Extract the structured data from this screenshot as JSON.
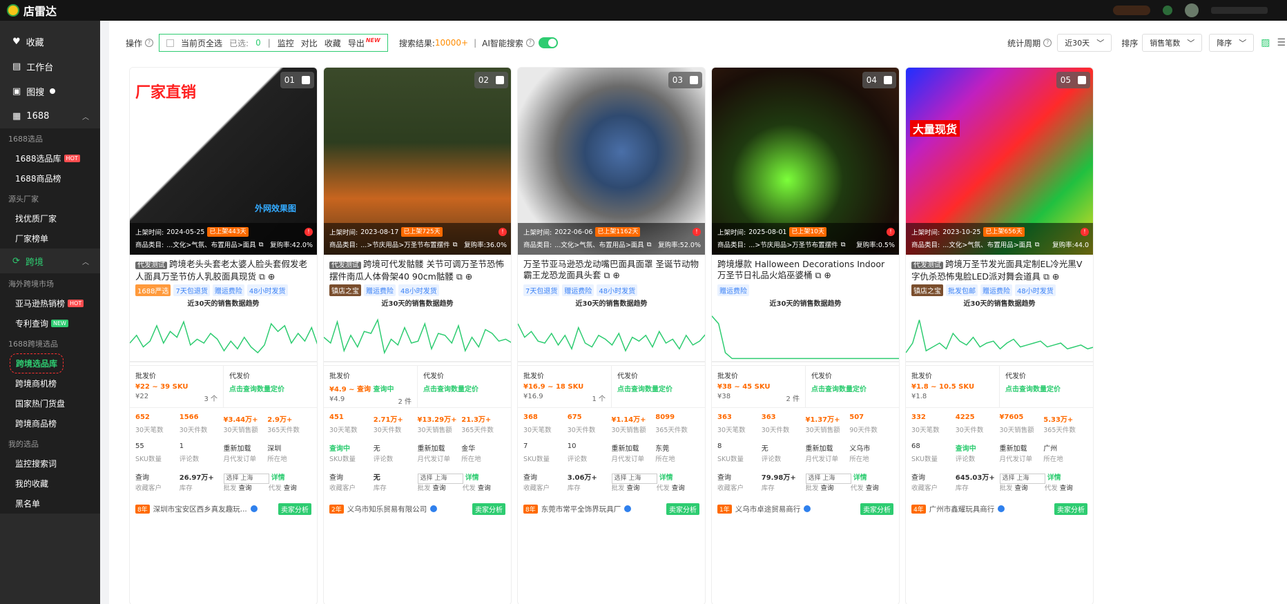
{
  "app": {
    "name": "店雷达"
  },
  "sidebar": {
    "items": [
      {
        "label": "收藏",
        "icon": "heart-icon"
      },
      {
        "label": "工作台",
        "icon": "workbench-icon"
      },
      {
        "label": "图搜",
        "icon": "image-search-icon"
      },
      {
        "label": "1688",
        "icon": "shop-icon"
      }
    ],
    "group_1688_selection": "1688选品",
    "item_1688_library": "1688选品库",
    "item_1688_goods": "1688商品榜",
    "group_factory": "源头厂家",
    "item_find_factory": "找优质厂家",
    "item_factory_rank": "厂家榜单",
    "cross_border": "跨境",
    "group_overseas": "海外跨境市场",
    "item_amazon": "亚马逊热销榜",
    "item_patent": "专利查询",
    "group_1688_cross": "1688跨境选品",
    "item_cross_library": "跨境选品库",
    "item_cross_opportunity": "跨境商机榜",
    "item_national_hot": "国家热门货盘",
    "item_cross_goods": "跨境商品榜",
    "group_my": "我的选品",
    "item_monitor": "监控搜索词",
    "item_my_fav": "我的收藏",
    "item_blacklist": "黑名单",
    "hot": "HOT",
    "new": "NEW"
  },
  "toolbar": {
    "op_label": "操作",
    "select_page": "当前页全选",
    "selected_label": "已选:",
    "selected_count": "0",
    "monitor": "监控",
    "compare": "对比",
    "favorite": "收藏",
    "export": "导出",
    "export_new": "NEW",
    "result_label": "搜索结果:",
    "result_count": "10000+",
    "ai_search": "AI智能搜索",
    "period_label": "统计周期",
    "period_value": "近30天",
    "sort_label": "排序",
    "sort_value": "销售笔数",
    "order_value": "降序"
  },
  "labels": {
    "listed_time": "上架时间:",
    "category": "商品类目:",
    "trend_title": "近30天的销售数据趋势",
    "wholesale": "批发价",
    "dropship": "代发价",
    "dropship_query": "点击查询数量定价",
    "m30_orders": "30天笔数",
    "m30_pieces": "30天件数",
    "m30_sales": "30天销售额",
    "y365_pieces": "365天件数",
    "d90_pieces": "90天件数",
    "sku_count": "SKU数量",
    "reviews": "评论数",
    "reload": "重新加载",
    "monthly_orders": "月代发订单",
    "location": "所在地",
    "fav_customers": "收藏客户",
    "stock": "库存",
    "wholesale_short": "批发",
    "dropship_short": "代发",
    "query": "查询",
    "detail": "详情",
    "seller_analysis": "卖家分析",
    "select_loc": "选择 上海"
  },
  "products": [
    {
      "no": "01",
      "date": "2024-05-25",
      "listed_badge": "已上架443天",
      "cat": "...文化>气氛、布置用品>面具",
      "repurchase": "复购率:42.0%",
      "tagline": "代发测试",
      "title": "跨境老头头套老太婆人脸头套假发老人面具万圣节仿人乳胶面具现货",
      "tags": [
        "1688严选",
        "7天包退货",
        "赠运费险",
        "48小时发货"
      ],
      "tag_types": [
        "o",
        "",
        "",
        ""
      ],
      "price": "¥22 ~ 39 SKU",
      "price_sub": "¥22",
      "price_count": "3 个",
      "orders": "652",
      "pieces": "1566",
      "sales": "¥3.44万+",
      "year": "2.9万+",
      "year_label": "365天件数",
      "sku": "55",
      "reviews": "1",
      "loc": "深圳",
      "fav": "查询",
      "stock": "26.97万+",
      "years": "8年",
      "company": "深圳市宝安区西乡真友趣玩..."
    },
    {
      "no": "02",
      "date": "2023-08-17",
      "listed_badge": "已上架725天",
      "cat": "...>节庆用品>万圣节布置摆件",
      "repurchase": "复购率:36.0%",
      "tagline": "代发测试",
      "title": "跨境可代发骷髅 关节可调万圣节恐怖摆件南瓜人体骨架40 90cm骷髅",
      "tags": [
        "镇店之宝",
        "赠运费险",
        "48小时发货"
      ],
      "tag_types": [
        "b",
        "",
        ""
      ],
      "price": "¥4.9 ~ 查询",
      "price_extra": "查询中",
      "price_sub": "¥4.9",
      "price_count": "2 件",
      "orders": "451",
      "pieces": "2.71万+",
      "sales": "¥13.29万+",
      "year": "21.3万+",
      "year_label": "365天件数",
      "sku": "查询中",
      "reviews": "无",
      "loc": "金华",
      "fav": "查询",
      "stock": "无",
      "years": "2年",
      "company": "义乌市知乐贸易有限公司"
    },
    {
      "no": "03",
      "date": "2022-06-06",
      "listed_badge": "已上架1162天",
      "cat": "...文化>气氛、布置用品>面具",
      "repurchase": "复购率:52.0%",
      "tagline": "",
      "title": "万圣节亚马逊恐龙动嘴巴面具面罩 圣诞节动物霸王龙恐龙面具头套",
      "tags": [
        "7天包退货",
        "赠运费险",
        "48小时发货"
      ],
      "tag_types": [
        "",
        "",
        ""
      ],
      "price": "¥16.9 ~ 18 SKU",
      "price_sub": "¥16.9",
      "price_count": "1 个",
      "orders": "368",
      "pieces": "675",
      "sales": "¥1.14万+",
      "year": "8099",
      "year_label": "365天件数",
      "sku": "7",
      "reviews": "10",
      "loc": "东莞",
      "fav": "查询",
      "stock": "3.06万+",
      "years": "8年",
      "company": "东莞市常平全饰界玩具厂"
    },
    {
      "no": "04",
      "date": "2025-08-01",
      "listed_badge": "已上架10天",
      "cat": "...>节庆用品>万圣节布置摆件",
      "repurchase": "复购率:0.5%",
      "tagline": "",
      "title": "跨境爆款 Halloween Decorations Indoor 万圣节日礼品火焰巫婆桶",
      "tags": [
        "赠运费险"
      ],
      "tag_types": [
        ""
      ],
      "price": "¥38 ~ 45 SKU",
      "price_sub": "¥38",
      "price_count": "2 件",
      "orders": "363",
      "pieces": "363",
      "sales": "¥1.37万+",
      "year": "507",
      "year_label": "90天件数",
      "sku": "8",
      "reviews": "无",
      "loc": "义乌市",
      "fav": "查询",
      "stock": "79.98万+",
      "years": "1年",
      "company": "义乌市卓途贸易商行"
    },
    {
      "no": "05",
      "date": "2023-10-25",
      "listed_badge": "已上架656天",
      "cat": "...文化>气氛、布置用品>面具",
      "repurchase": "复购率:44.0",
      "tagline": "代发测试",
      "title": "跨境万圣节发光面具定制EL冷光黑V字仇杀恐怖鬼脸LED派对舞会道具",
      "tags": [
        "镇店之宝",
        "批发包邮",
        "赠运费险",
        "48小时发货"
      ],
      "tag_types": [
        "b",
        "",
        "",
        ""
      ],
      "price": "¥1.8 ~ 10.5 SKU",
      "price_sub": "¥1.8",
      "price_count": "",
      "orders": "332",
      "pieces": "4225",
      "sales": "¥7605",
      "year": "5.33万+",
      "year_label": "365天件数",
      "sku": "68",
      "reviews": "查询中",
      "loc": "广州",
      "fav": "查询",
      "stock": "645.03万+",
      "years": "4年",
      "company": "广州市鑫耀玩具商行"
    }
  ],
  "image_overlay": {
    "p1_banner": "厂家直销",
    "p1_caption": "外网效果图",
    "p5_banner": "大量现货"
  },
  "colors": {
    "accent": "#2ecc71",
    "orange": "#ff6a00",
    "sidebar": "#2b2b2b"
  }
}
